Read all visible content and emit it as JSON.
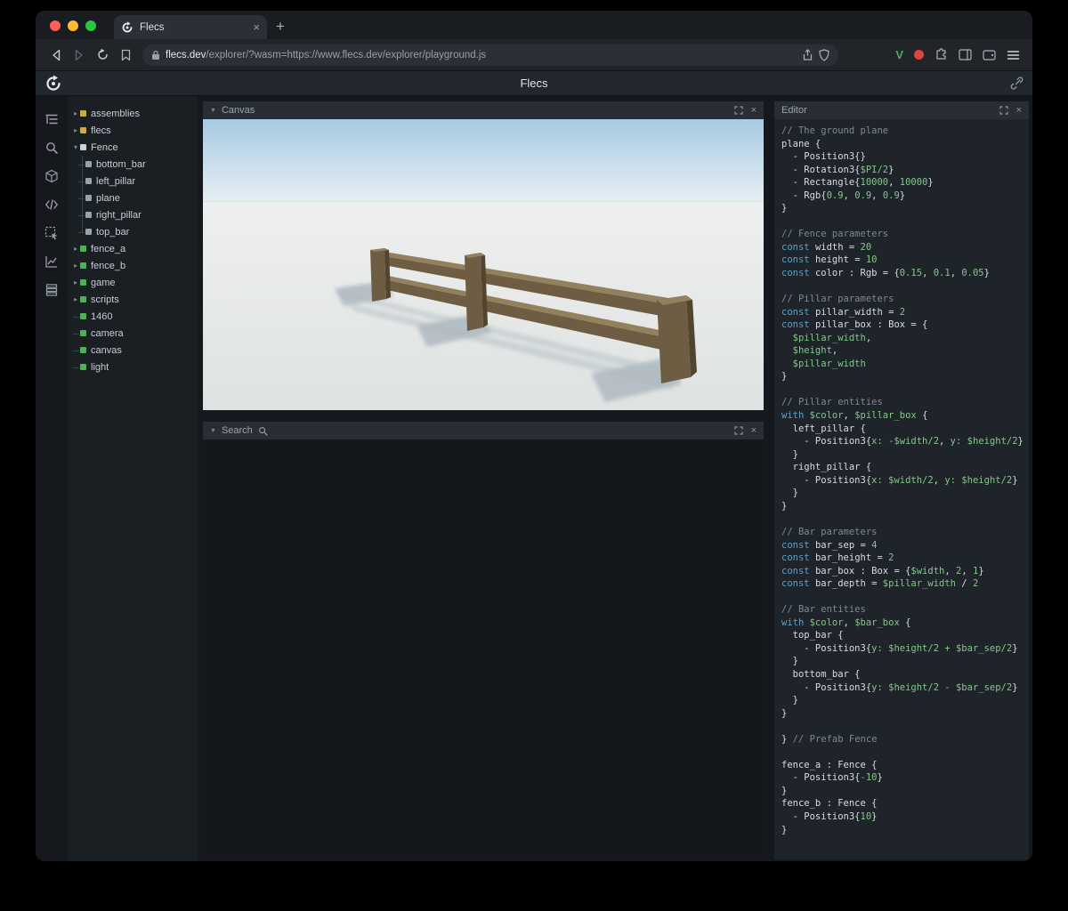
{
  "browser": {
    "tab": {
      "title": "Flecs"
    },
    "new_tab_label": "+",
    "url": {
      "domain": "flecs.dev",
      "path": "/explorer/?wasm=https://www.flecs.dev/explorer/playground.js"
    },
    "extensions": [
      "brave-v-extension",
      "red-dot-extension",
      "puzzle-extensions",
      "sidebar-toggle",
      "wallet",
      "menu"
    ]
  },
  "app": {
    "title": "Flecs"
  },
  "sidebar": {
    "icons": [
      "entity-tree-icon",
      "search-icon",
      "cube-icon",
      "code-icon",
      "select-icon",
      "chart-icon",
      "rows-icon"
    ]
  },
  "panels": {
    "canvas": {
      "title": "Canvas"
    },
    "search": {
      "title": "Search"
    },
    "editor": {
      "title": "Editor"
    }
  },
  "tree": {
    "colors": {
      "module": "#c9ad3f",
      "prefab": "#ccd3d8",
      "child": "#98a2a8",
      "entity": "#4fae57"
    },
    "items": [
      {
        "label": "assemblies",
        "kind": "module",
        "arrow": "right",
        "depth": 0
      },
      {
        "label": "flecs",
        "kind": "module",
        "arrow": "right",
        "depth": 0
      },
      {
        "label": "Fence",
        "kind": "prefab",
        "arrow": "down",
        "depth": 0
      },
      {
        "label": "bottom_bar",
        "kind": "child",
        "arrow": "none",
        "depth": 1
      },
      {
        "label": "left_pillar",
        "kind": "child",
        "arrow": "none",
        "depth": 1
      },
      {
        "label": "plane",
        "kind": "child",
        "arrow": "none",
        "depth": 1
      },
      {
        "label": "right_pillar",
        "kind": "child",
        "arrow": "none",
        "depth": 1
      },
      {
        "label": "top_bar",
        "kind": "child",
        "arrow": "none",
        "depth": 1
      },
      {
        "label": "fence_a",
        "kind": "entity",
        "arrow": "right",
        "depth": 0
      },
      {
        "label": "fence_b",
        "kind": "entity",
        "arrow": "right",
        "depth": 0
      },
      {
        "label": "game",
        "kind": "entity",
        "arrow": "right",
        "depth": 0
      },
      {
        "label": "scripts",
        "kind": "entity",
        "arrow": "right",
        "depth": 0
      },
      {
        "label": "1460",
        "kind": "entity",
        "arrow": "none",
        "depth": 0
      },
      {
        "label": "camera",
        "kind": "entity",
        "arrow": "none",
        "depth": 0
      },
      {
        "label": "canvas",
        "kind": "entity",
        "arrow": "none",
        "depth": 0
      },
      {
        "label": "light",
        "kind": "entity",
        "arrow": "none",
        "depth": 0
      }
    ]
  },
  "scene": {
    "description": "3D viewport: wooden fence prefab on large ground plane under blue sky",
    "colors": {
      "sky_top": "#a7cae3",
      "sky_horizon": "#e6eef3",
      "ground_far": "#eef0ef",
      "ground_near": "#dee2e1",
      "wood_light": "#93805c",
      "wood_mid": "#6e5c43",
      "wood_dark": "#52452f",
      "shadow": "#aeb9bf"
    }
  },
  "editor": {
    "token_colors": {
      "d": "#d7dde1",
      "c": "#7e898e",
      "k": "#55a1d9",
      "g": "#83c789"
    },
    "lines": [
      [
        [
          "c",
          "// The ground plane"
        ]
      ],
      [
        [
          "d",
          "plane {"
        ]
      ],
      [
        [
          "d",
          "  - Position3{}"
        ]
      ],
      [
        [
          "d",
          "  - Rotation3{"
        ],
        [
          "g",
          "$PI/2"
        ],
        [
          "d",
          "}"
        ]
      ],
      [
        [
          "d",
          "  - Rectangle{"
        ],
        [
          "g",
          "10000"
        ],
        [
          "d",
          ", "
        ],
        [
          "g",
          "10000"
        ],
        [
          "d",
          "}"
        ]
      ],
      [
        [
          "d",
          "  - Rgb{"
        ],
        [
          "g",
          "0.9"
        ],
        [
          "d",
          ", "
        ],
        [
          "g",
          "0.9"
        ],
        [
          "d",
          ", "
        ],
        [
          "g",
          "0.9"
        ],
        [
          "d",
          "}"
        ]
      ],
      [
        [
          "d",
          "}"
        ]
      ],
      [],
      [
        [
          "c",
          "// Fence parameters"
        ]
      ],
      [
        [
          "k",
          "const "
        ],
        [
          "d",
          "width = "
        ],
        [
          "g",
          "20"
        ]
      ],
      [
        [
          "k",
          "const "
        ],
        [
          "d",
          "height = "
        ],
        [
          "g",
          "10"
        ]
      ],
      [
        [
          "k",
          "const "
        ],
        [
          "d",
          "color : Rgb = {"
        ],
        [
          "g",
          "0.15"
        ],
        [
          "d",
          ", "
        ],
        [
          "g",
          "0.1"
        ],
        [
          "d",
          ", "
        ],
        [
          "g",
          "0.05"
        ],
        [
          "d",
          "}"
        ]
      ],
      [],
      [
        [
          "c",
          "// Pillar parameters"
        ]
      ],
      [
        [
          "k",
          "const "
        ],
        [
          "d",
          "pillar_width = "
        ],
        [
          "g",
          "2"
        ]
      ],
      [
        [
          "k",
          "const "
        ],
        [
          "d",
          "pillar_box : Box = {"
        ]
      ],
      [
        [
          "g",
          "  $pillar_width"
        ],
        [
          "d",
          ","
        ]
      ],
      [
        [
          "g",
          "  $height"
        ],
        [
          "d",
          ","
        ]
      ],
      [
        [
          "g",
          "  $pillar_width"
        ]
      ],
      [
        [
          "d",
          "}"
        ]
      ],
      [],
      [
        [
          "c",
          "// Pillar entities"
        ]
      ],
      [
        [
          "k",
          "with "
        ],
        [
          "g",
          "$color"
        ],
        [
          "d",
          ", "
        ],
        [
          "g",
          "$pillar_box"
        ],
        [
          "d",
          " {"
        ]
      ],
      [
        [
          "d",
          "  left_pillar {"
        ]
      ],
      [
        [
          "d",
          "    - Position3{"
        ],
        [
          "g",
          "x: -$width/2"
        ],
        [
          "d",
          ", "
        ],
        [
          "g",
          "y: $height/2"
        ],
        [
          "d",
          "}"
        ]
      ],
      [
        [
          "d",
          "  }"
        ]
      ],
      [
        [
          "d",
          "  right_pillar {"
        ]
      ],
      [
        [
          "d",
          "    - Position3{"
        ],
        [
          "g",
          "x: $width/2"
        ],
        [
          "d",
          ", "
        ],
        [
          "g",
          "y: $height/2"
        ],
        [
          "d",
          "}"
        ]
      ],
      [
        [
          "d",
          "  }"
        ]
      ],
      [
        [
          "d",
          "}"
        ]
      ],
      [],
      [
        [
          "c",
          "// Bar parameters"
        ]
      ],
      [
        [
          "k",
          "const "
        ],
        [
          "d",
          "bar_sep = "
        ],
        [
          "g",
          "4"
        ]
      ],
      [
        [
          "k",
          "const "
        ],
        [
          "d",
          "bar_height = "
        ],
        [
          "g",
          "2"
        ]
      ],
      [
        [
          "k",
          "const "
        ],
        [
          "d",
          "bar_box : Box = {"
        ],
        [
          "g",
          "$width"
        ],
        [
          "d",
          ", "
        ],
        [
          "g",
          "2"
        ],
        [
          "d",
          ", "
        ],
        [
          "g",
          "1"
        ],
        [
          "d",
          "}"
        ]
      ],
      [
        [
          "k",
          "const "
        ],
        [
          "d",
          "bar_depth = "
        ],
        [
          "g",
          "$pillar_width"
        ],
        [
          "d",
          " / "
        ],
        [
          "g",
          "2"
        ]
      ],
      [],
      [
        [
          "c",
          "// Bar entities"
        ]
      ],
      [
        [
          "k",
          "with "
        ],
        [
          "g",
          "$color"
        ],
        [
          "d",
          ", "
        ],
        [
          "g",
          "$bar_box"
        ],
        [
          "d",
          " {"
        ]
      ],
      [
        [
          "d",
          "  top_bar {"
        ]
      ],
      [
        [
          "d",
          "    - Position3{"
        ],
        [
          "g",
          "y: $height/2 + $bar_sep/2"
        ],
        [
          "d",
          "}"
        ]
      ],
      [
        [
          "d",
          "  }"
        ]
      ],
      [
        [
          "d",
          "  bottom_bar {"
        ]
      ],
      [
        [
          "d",
          "    - Position3{"
        ],
        [
          "g",
          "y: $height/2 - $bar_sep/2"
        ],
        [
          "d",
          "}"
        ]
      ],
      [
        [
          "d",
          "  }"
        ]
      ],
      [
        [
          "d",
          "}"
        ]
      ],
      [],
      [
        [
          "d",
          "} "
        ],
        [
          "c",
          "// Prefab Fence"
        ]
      ],
      [],
      [
        [
          "d",
          "fence_a : Fence {"
        ]
      ],
      [
        [
          "d",
          "  - Position3{"
        ],
        [
          "g",
          "-10"
        ],
        [
          "d",
          "}"
        ]
      ],
      [
        [
          "d",
          "}"
        ]
      ],
      [
        [
          "d",
          "fence_b : Fence {"
        ]
      ],
      [
        [
          "d",
          "  - Position3{"
        ],
        [
          "g",
          "10"
        ],
        [
          "d",
          "}"
        ]
      ],
      [
        [
          "d",
          "}"
        ]
      ]
    ]
  }
}
